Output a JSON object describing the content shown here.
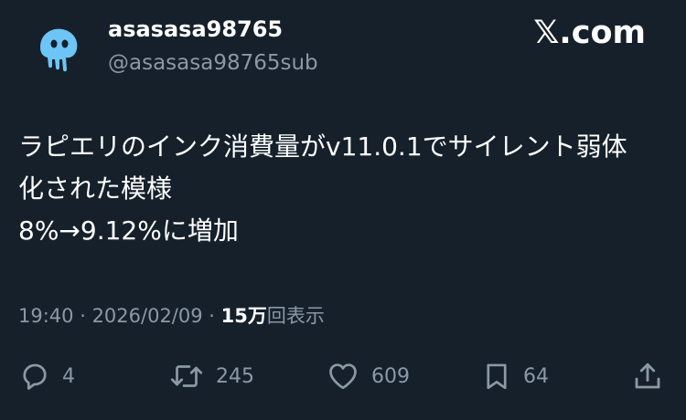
{
  "user": {
    "display_name": "asasasa98765",
    "handle": "@asasasa98765sub",
    "avatar_icon": "jellyfish-icon",
    "avatar_color": "#6cc5f5"
  },
  "brand": {
    "label": "𝕏.com"
  },
  "tweet": {
    "lines": [
      "ラピエリのインク消費量がv11.0.1でサイレント弱体",
      "化された模様",
      "8%→9.12%に増加"
    ]
  },
  "meta": {
    "time": "19:40",
    "separator": " · ",
    "date": "2026/02/09",
    "views_count": "15万",
    "views_label": "回表示"
  },
  "actions": {
    "reply": {
      "icon": "reply-icon",
      "count": "4"
    },
    "repost": {
      "icon": "repost-icon",
      "count": "245"
    },
    "like": {
      "icon": "heart-icon",
      "count": "609"
    },
    "bookmark": {
      "icon": "bookmark-icon",
      "count": "64"
    },
    "share": {
      "icon": "share-icon"
    }
  },
  "colors": {
    "background": "#15202b",
    "text_primary": "#ffffff",
    "text_secondary": "#8b98a5"
  }
}
